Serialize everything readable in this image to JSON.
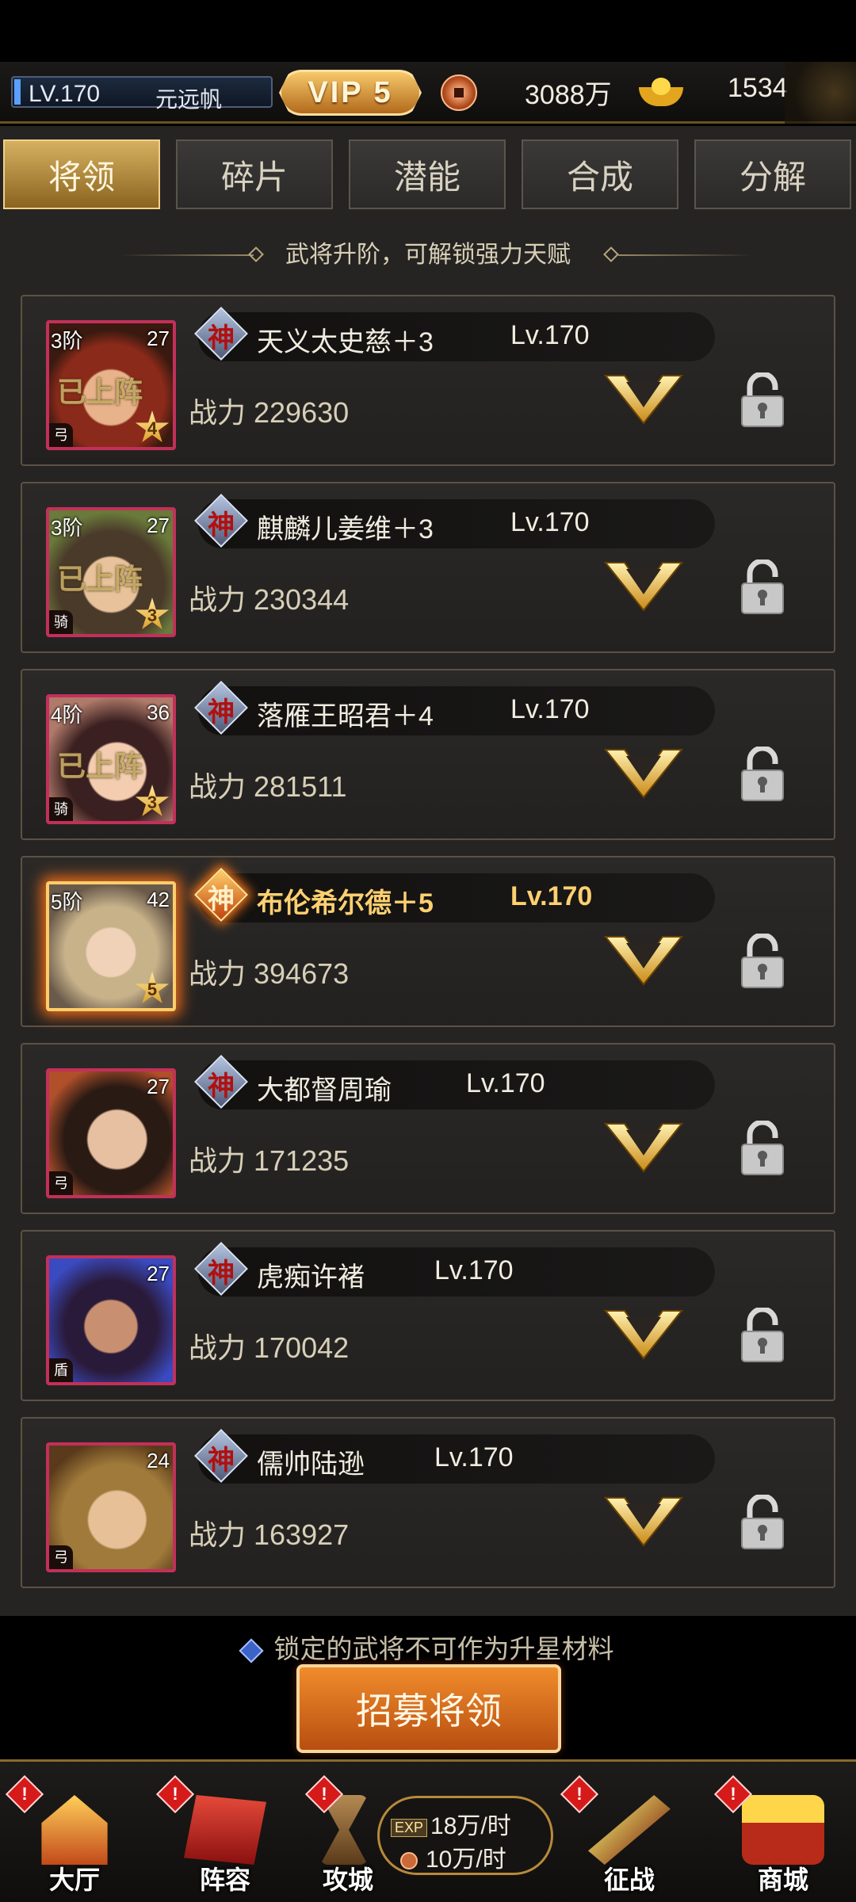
{
  "topbar": {
    "level": "LV.170",
    "player_name": "元远帆",
    "vip": "VIP 5",
    "copper": "3088万",
    "gold": "1534"
  },
  "tabs": [
    {
      "label": "将领",
      "active": true
    },
    {
      "label": "碎片",
      "active": false
    },
    {
      "label": "潜能",
      "active": false
    },
    {
      "label": "合成",
      "active": false
    },
    {
      "label": "分解",
      "active": false
    }
  ],
  "subtitle": "武将升阶，可解锁强力天赋",
  "divine_char": "神",
  "heroes": [
    {
      "rank": "3阶",
      "level_badge": "27",
      "deployed": "已上阵",
      "stars": "4",
      "faction": "弓",
      "name": "天义太史慈＋3",
      "level": "Lv.170",
      "power": "战力 229630",
      "gold": false
    },
    {
      "rank": "3阶",
      "level_badge": "27",
      "deployed": "已上阵",
      "stars": "3",
      "faction": "骑",
      "name": "麒麟儿姜维＋3",
      "level": "Lv.170",
      "power": "战力 230344",
      "gold": false
    },
    {
      "rank": "4阶",
      "level_badge": "36",
      "deployed": "已上阵",
      "stars": "3",
      "faction": "骑",
      "name": "落雁王昭君＋4",
      "level": "Lv.170",
      "power": "战力 281511",
      "gold": false
    },
    {
      "rank": "5阶",
      "level_badge": "42",
      "deployed": "",
      "stars": "5",
      "faction": "",
      "name": "布伦希尔德＋5",
      "level": "Lv.170",
      "power": "战力 394673",
      "gold": true
    },
    {
      "rank": "",
      "level_badge": "27",
      "deployed": "",
      "stars": "",
      "faction": "弓",
      "name": "大都督周瑜",
      "level": "Lv.170",
      "power": "战力 171235",
      "gold": false
    },
    {
      "rank": "",
      "level_badge": "27",
      "deployed": "",
      "stars": "",
      "faction": "盾",
      "name": "虎痴许褚",
      "level": "Lv.170",
      "power": "战力 170042",
      "gold": false
    },
    {
      "rank": "",
      "level_badge": "24",
      "deployed": "",
      "stars": "",
      "faction": "弓",
      "name": "儒帅陆逊",
      "level": "Lv.170",
      "power": "战力 163927",
      "gold": false
    }
  ],
  "notice": "锁定的武将不可作为升星材料",
  "recruit_button": "招募将领",
  "nav": [
    {
      "label": "大厅",
      "badge": "!"
    },
    {
      "label": "阵容",
      "badge": "!"
    },
    {
      "label": "攻城",
      "badge": "!"
    },
    {
      "label": "征战",
      "badge": "!"
    },
    {
      "label": "商城",
      "badge": "!"
    }
  ],
  "idle": {
    "exp_tag": "EXP",
    "exp_rate": "18万/时",
    "coin_rate": "10万/时"
  },
  "colors": {
    "accent_gold": "#d6b060",
    "portrait_border": "#c2305a",
    "background": "#262422"
  }
}
